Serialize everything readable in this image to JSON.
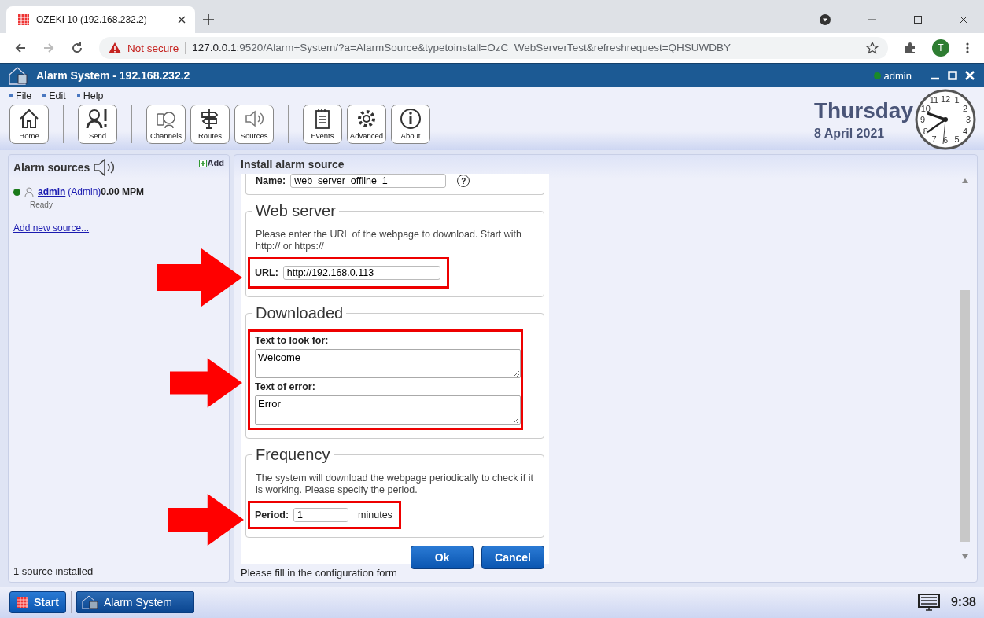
{
  "browser": {
    "tab_title": "OZEKI 10 (192.168.232.2)",
    "security": "Not secure",
    "url_host": "127.0.0.1",
    "url_rest": ":9520/Alarm+System/?a=AlarmSource&typetoinstall=OzC_WebServerTest&refreshrequest=QHSUWDBY",
    "profile": "T"
  },
  "app": {
    "title": "Alarm System - 192.168.232.2",
    "user": "admin"
  },
  "menu": [
    "File",
    "Edit",
    "Help"
  ],
  "toolbar_groups": [
    [
      "Home"
    ],
    [
      "Send"
    ],
    [
      "Channels",
      "Routes",
      "Sources"
    ],
    [
      "Events",
      "Advanced",
      "About"
    ]
  ],
  "date": {
    "day": "Thursday",
    "date": "8 April 2021"
  },
  "clock": {
    "numerals": [
      "11",
      "12",
      "1",
      "10",
      "2",
      "9",
      "3",
      "8",
      "4",
      "7",
      "6",
      "5"
    ]
  },
  "sidebar": {
    "title": "Alarm sources",
    "add": "Add",
    "sources": [
      {
        "name": "admin",
        "role": "(Admin)",
        "rate": "0.00 MPM",
        "status": "Ready",
        "color": "#1a7a1a"
      }
    ],
    "add_link": "Add new source...",
    "footer": "1 source installed"
  },
  "form": {
    "title": "Install alarm source",
    "name_label": "Name:",
    "name_value": "web_server_offline_1",
    "help": "?",
    "web_server": {
      "legend": "Web server",
      "text": "Please enter the URL of the webpage to download. Start with http:// or https://",
      "url_label": "URL:",
      "url_value": "http://192.168.0.113"
    },
    "downloaded": {
      "legend": "Downloaded",
      "look_label": "Text to look for:",
      "look_value": "Welcome",
      "error_label": "Text of error:",
      "error_value": "Error"
    },
    "frequency": {
      "legend": "Frequency",
      "text": "The system will download the webpage periodically to check if it is working. Please specify the period.",
      "period_label": "Period:",
      "period_value": "1",
      "unit": "minutes"
    },
    "buttons": [
      "Ok",
      "Cancel"
    ],
    "status": "Please fill in the configuration form"
  },
  "taskbar": {
    "start": "Start",
    "task": "Alarm System",
    "time": "9:38"
  }
}
